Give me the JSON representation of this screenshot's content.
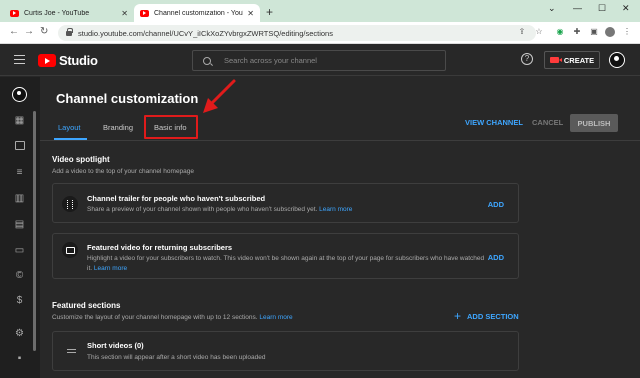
{
  "browser": {
    "tabs": [
      {
        "title": "Curtis Joe - YouTube",
        "active": false
      },
      {
        "title": "Channel customization - YouTub",
        "active": true
      }
    ],
    "url": "studio.youtube.com/channel/UCvY_iICkXoZYvbrgxZWRTSQ/editing/sections"
  },
  "header": {
    "logo_text": "Studio",
    "search_placeholder": "Search across your channel",
    "create_label": "CREATE"
  },
  "page": {
    "title": "Channel customization",
    "tabs": [
      "Layout",
      "Branding",
      "Basic info"
    ],
    "active_tab": "Layout",
    "actions": {
      "view_channel": "VIEW CHANNEL",
      "cancel": "CANCEL",
      "publish": "PUBLISH"
    }
  },
  "video_spotlight": {
    "title": "Video spotlight",
    "subtitle": "Add a video to the top of your channel homepage",
    "cards": [
      {
        "title": "Channel trailer for people who haven't subscribed",
        "desc": "Share a preview of your channel shown with people who haven't subscribed yet.",
        "link": "Learn more",
        "action": "ADD"
      },
      {
        "title": "Featured video for returning subscribers",
        "desc": "Highlight a video for your subscribers to watch. This video won't be shown again at the top of your page for subscribers who have watched it.",
        "link": "Learn more",
        "action": "ADD"
      }
    ]
  },
  "featured_sections": {
    "title": "Featured sections",
    "subtitle": "Customize the layout of your channel homepage with up to 12 sections.",
    "link": "Learn more",
    "add_section": "ADD SECTION",
    "items": [
      {
        "title": "Short videos (0)",
        "desc": "This section will appear after a short video has been uploaded"
      }
    ]
  },
  "colors": {
    "accent": "#3ea6ff",
    "highlight": "#e01b1b",
    "brand": "#ff0000"
  },
  "icons": [
    "back-arrow-icon",
    "forward-arrow-icon",
    "reload-icon",
    "lock-icon",
    "search-icon",
    "help-icon",
    "camera-icon",
    "avatar-icon",
    "dashboard-icon",
    "content-icon",
    "playlists-icon",
    "analytics-icon",
    "comments-icon",
    "subtitles-icon",
    "copyright-icon",
    "earn-icon",
    "settings-icon",
    "feedback-icon"
  ]
}
